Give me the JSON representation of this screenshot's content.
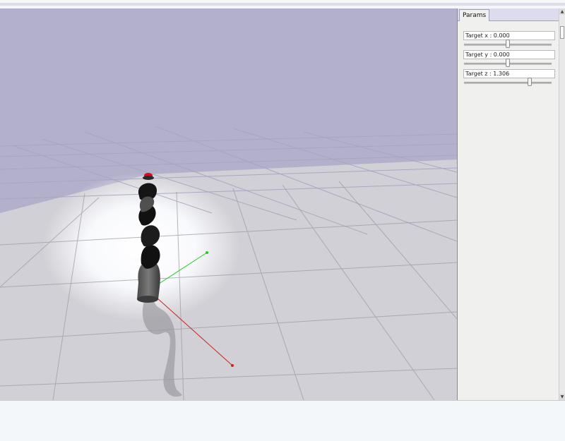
{
  "panel": {
    "tab_label": "Params",
    "params": [
      {
        "label": "Target x : 0.000",
        "value": 0.0,
        "fraction": 0.5
      },
      {
        "label": "Target y : 0.000",
        "value": 0.0,
        "fraction": 0.5
      },
      {
        "label": "Target z : 1.306",
        "value": 1.306,
        "fraction": 0.75
      }
    ]
  },
  "scene": {
    "sky_color": "#b3b0cb",
    "floor_color": "#cfcfd4",
    "x_axis_color": "#cc2222",
    "y_axis_color": "#22cc22",
    "target_marker_color": "#d01020"
  }
}
